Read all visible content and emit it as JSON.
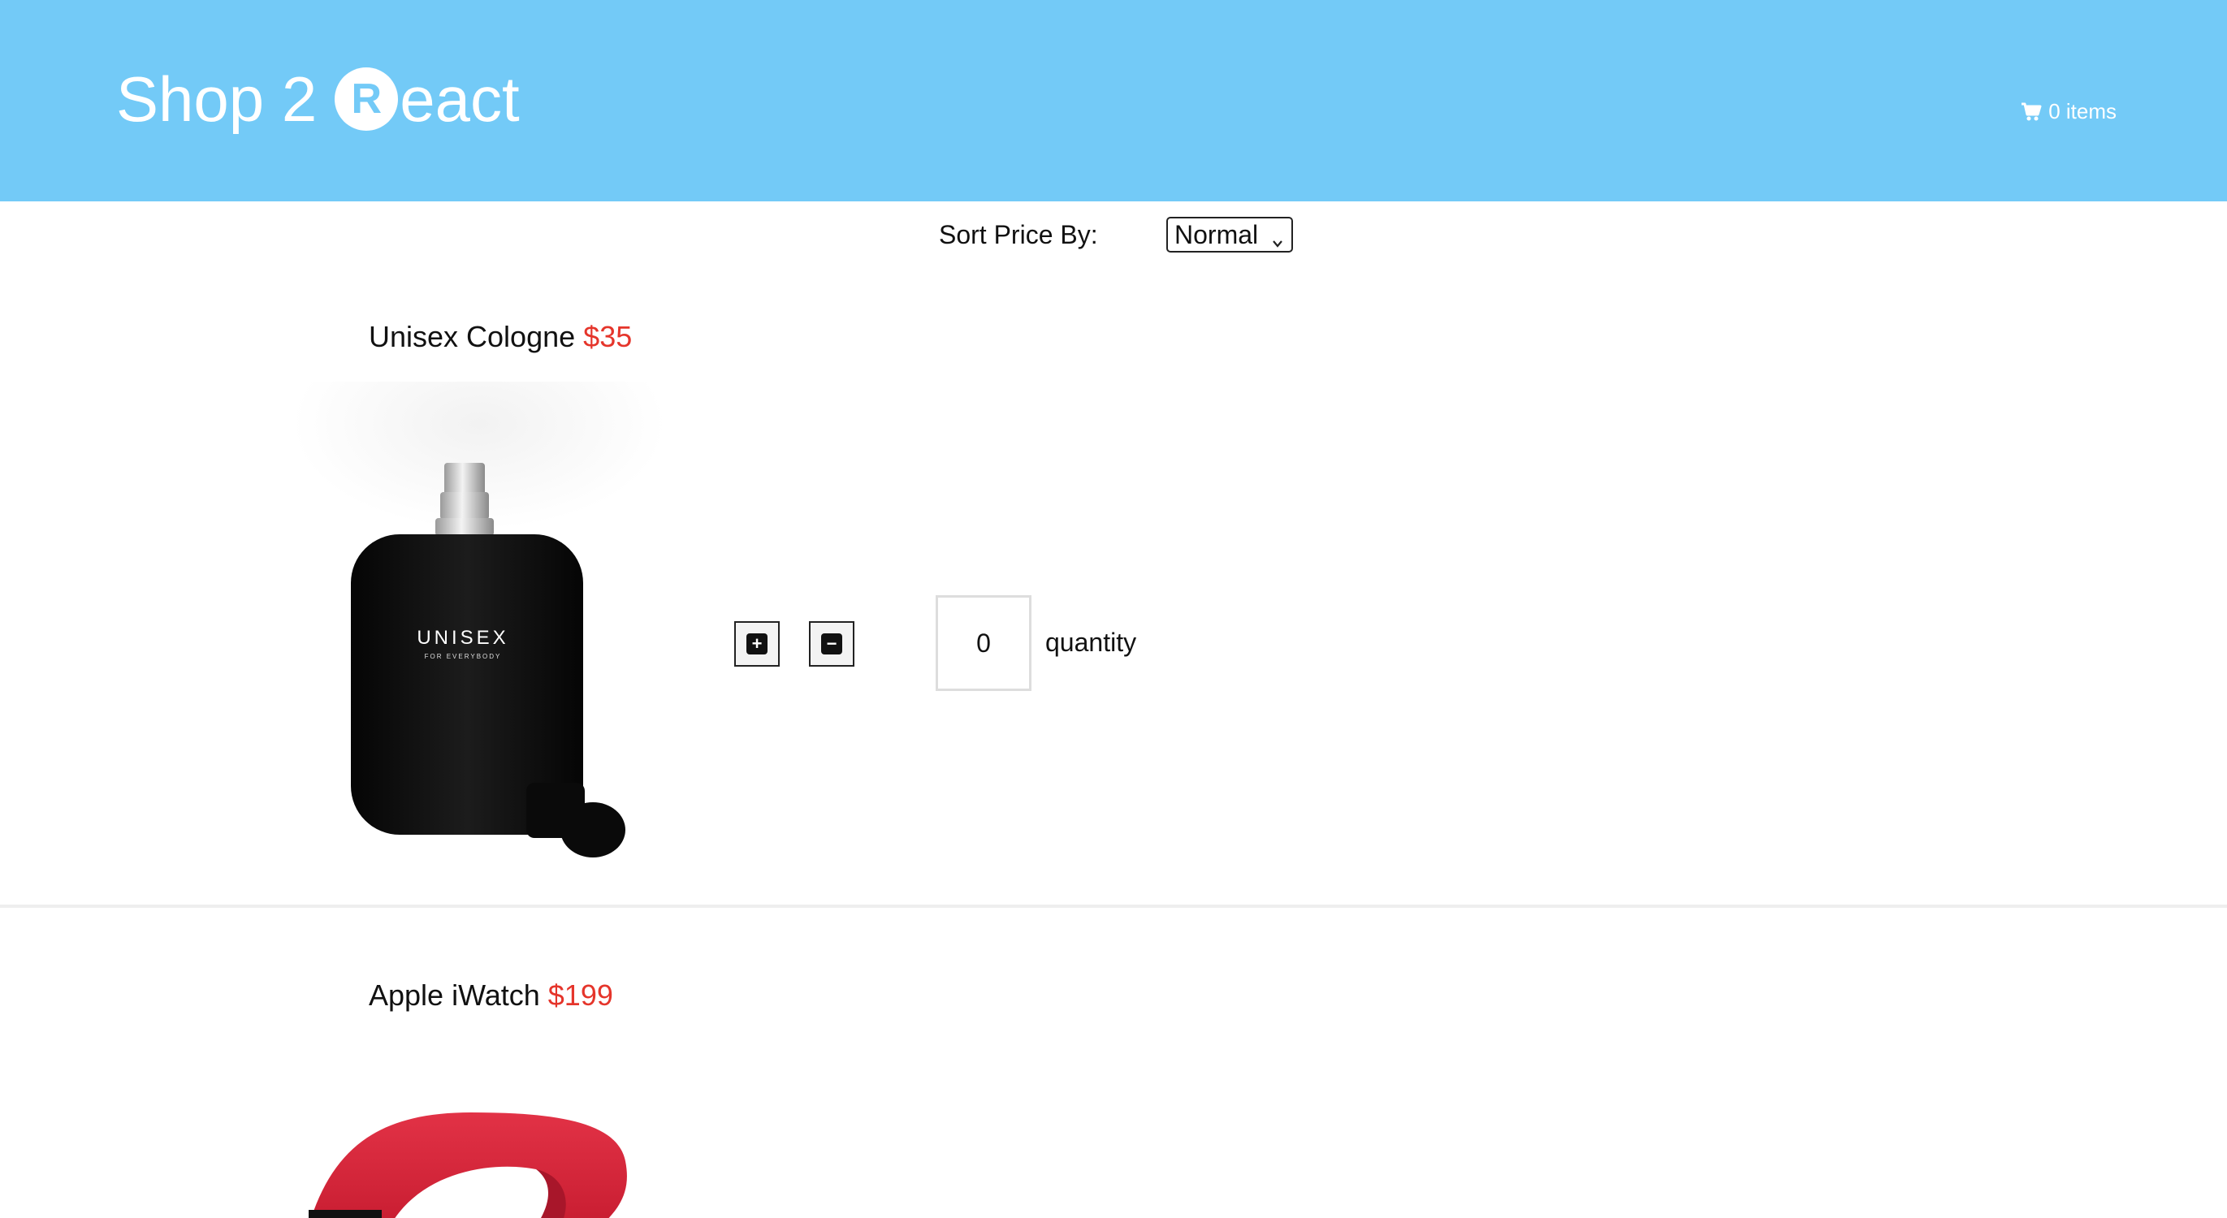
{
  "header": {
    "logo_prefix": "Shop 2",
    "logo_circle_letter": "R",
    "logo_suffix": "eact",
    "cart_label": "0 items",
    "background": "#73caf7"
  },
  "sort": {
    "label": "Sort Price By:",
    "selected": "Normal"
  },
  "products": [
    {
      "name": "Unisex Cologne",
      "price": "$35",
      "image_text": "UNISEX",
      "image_subtext": "FOR EVERYBODY",
      "increment_icon": "plus-square-icon",
      "decrement_icon": "minus-square-icon",
      "quantity": "0",
      "quantity_label": "quantity"
    },
    {
      "name": "Apple iWatch",
      "price": "$199"
    }
  ],
  "colors": {
    "price": "#e5352b",
    "divider": "#eeeeee"
  }
}
